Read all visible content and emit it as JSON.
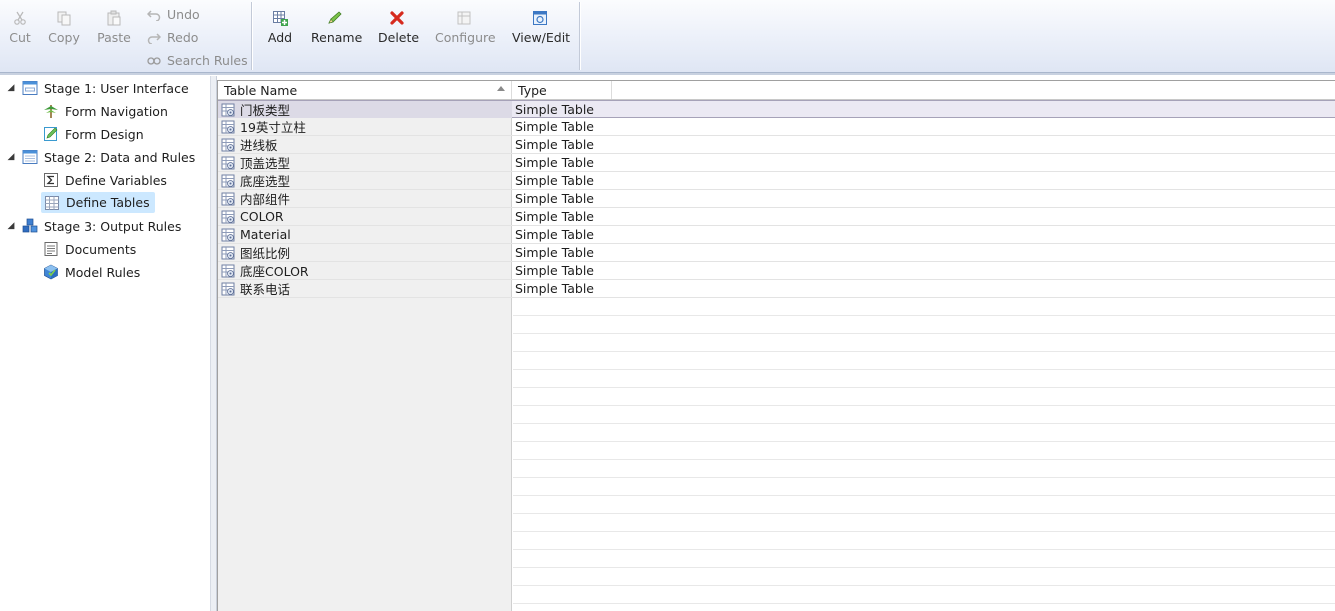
{
  "toolbar": {
    "clipboard": {
      "cut": "Cut",
      "copy": "Copy",
      "paste": "Paste"
    },
    "history": {
      "undo": "Undo",
      "redo": "Redo",
      "search_rules": "Search Rules"
    },
    "table_actions": {
      "add": "Add",
      "rename": "Rename",
      "delete": "Delete",
      "configure": "Configure",
      "view_edit": "View/Edit"
    }
  },
  "sidebar": {
    "stages": [
      {
        "label": "Stage 1: User Interface",
        "icon": "window-icon",
        "children": [
          {
            "label": "Form Navigation",
            "icon": "tree-icon"
          },
          {
            "label": "Form Design",
            "icon": "form-edit-icon"
          }
        ]
      },
      {
        "label": "Stage 2: Data and Rules",
        "icon": "data-window-icon",
        "children": [
          {
            "label": "Define Variables",
            "icon": "sigma-icon"
          },
          {
            "label": "Define Tables",
            "icon": "table-icon",
            "selected": true
          }
        ]
      },
      {
        "label": "Stage 3: Output Rules",
        "icon": "cubes-icon",
        "children": [
          {
            "label": "Documents",
            "icon": "document-icon"
          },
          {
            "label": "Model Rules",
            "icon": "model-icon"
          }
        ]
      }
    ]
  },
  "grid": {
    "columns": [
      "Table Name",
      "Type"
    ],
    "sort_column": "Table Name",
    "sort_direction": "ascending",
    "rows": [
      {
        "name": "门板类型",
        "type": "Simple Table"
      },
      {
        "name": "19英寸立柱",
        "type": "Simple Table"
      },
      {
        "name": "进线板",
        "type": "Simple Table"
      },
      {
        "name": "顶盖选型",
        "type": "Simple Table"
      },
      {
        "name": "底座选型",
        "type": "Simple Table"
      },
      {
        "name": "内部组件",
        "type": "Simple Table"
      },
      {
        "name": "COLOR",
        "type": "Simple Table"
      },
      {
        "name": "Material",
        "type": "Simple Table"
      },
      {
        "name": "图纸比例",
        "type": "Simple Table"
      },
      {
        "name": "底座COLOR",
        "type": "Simple Table"
      },
      {
        "name": "联系电话",
        "type": "Simple Table"
      }
    ],
    "selected_row": 0
  },
  "colors": {
    "ribbon_top": "#fbfcfe",
    "ribbon_bottom": "#dfe6f4",
    "nav_selected": "#cce8ff",
    "row_selected": "#ebe9f3",
    "delete_red": "#d62a1e",
    "rename_green": "#4aa33a"
  }
}
